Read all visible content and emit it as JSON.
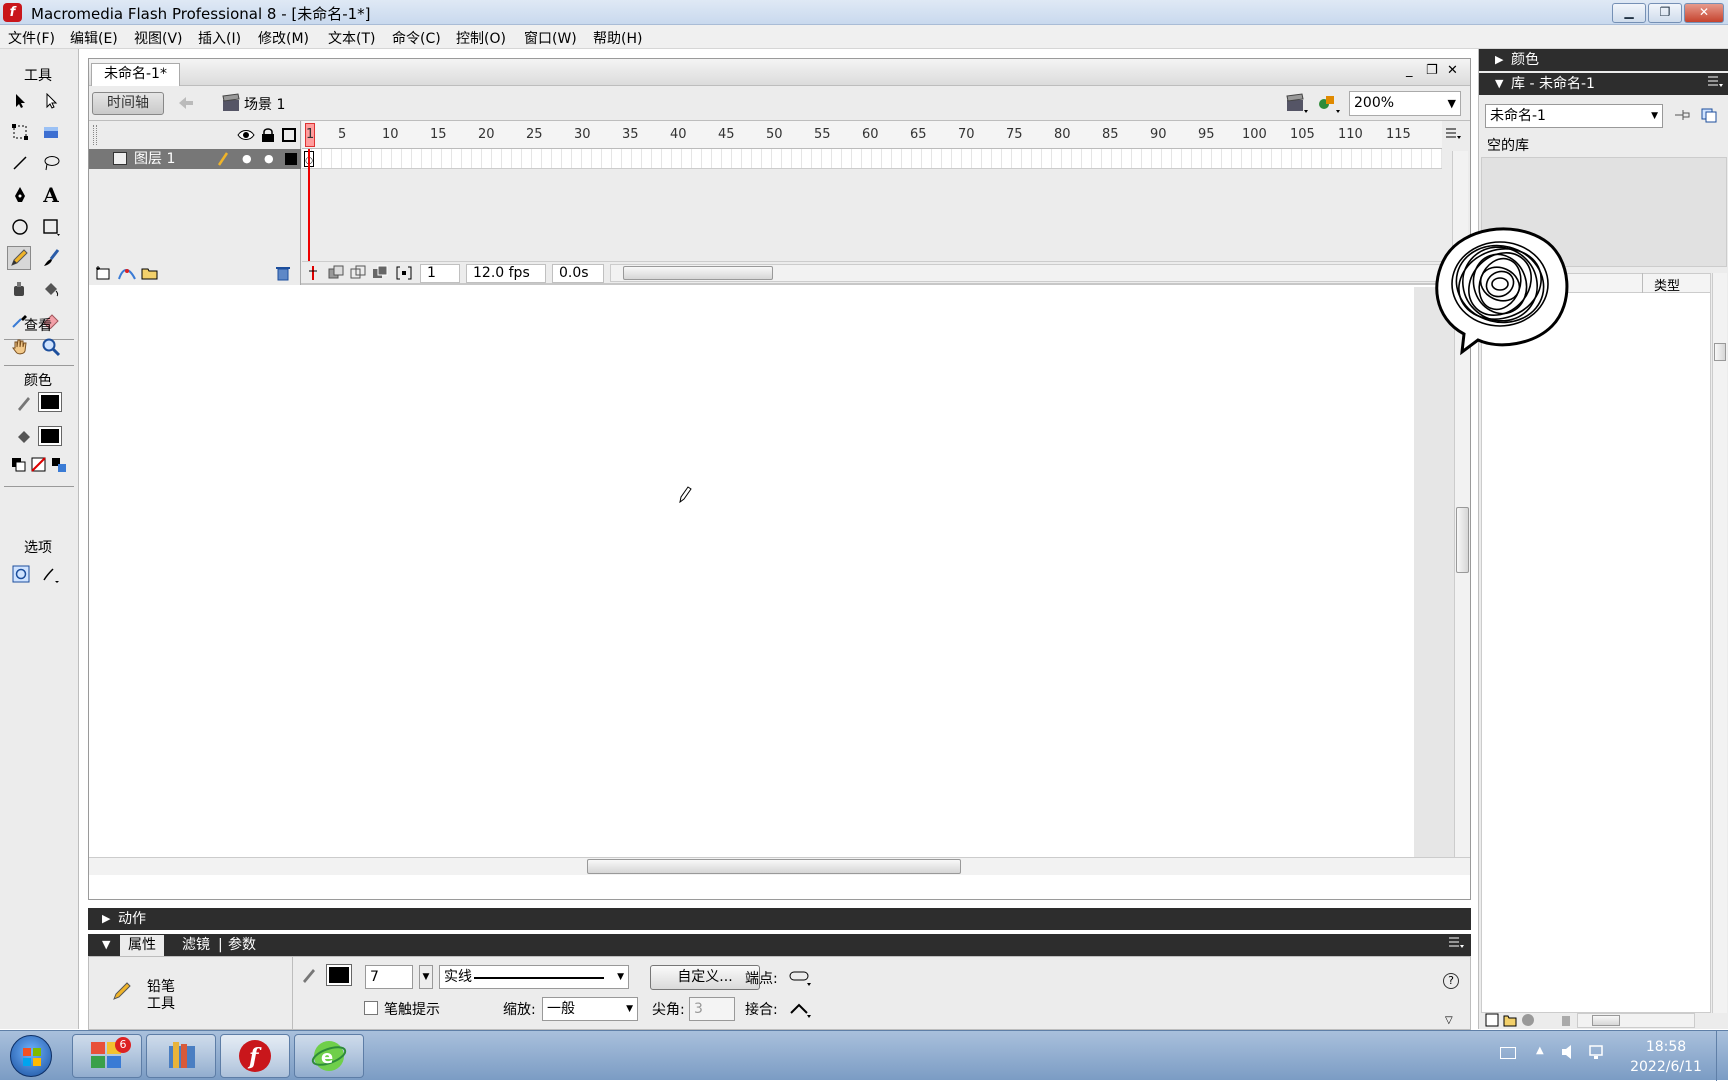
{
  "window": {
    "title": "Macromedia Flash Professional 8 - [未命名-1*]",
    "logo_glyph": "f"
  },
  "menu": [
    "文件(F)",
    "编辑(E)",
    "视图(V)",
    "插入(I)",
    "修改(M)",
    "文本(T)",
    "命令(C)",
    "控制(O)",
    "窗口(W)",
    "帮助(H)"
  ],
  "tools": {
    "heading": "工具",
    "view_heading": "查看",
    "colors_heading": "颜色",
    "options_heading": "选项",
    "active_tool": "pencil-tool"
  },
  "document": {
    "tab": "未命名-1*",
    "timeline_button": "时间轴",
    "scene": "场景 1",
    "zoom": "200%",
    "doc_controls": [
      "_",
      "❐",
      "✕"
    ]
  },
  "timeline": {
    "ruler": [
      "1",
      "5",
      "10",
      "15",
      "20",
      "25",
      "30",
      "35",
      "40",
      "45",
      "50",
      "55",
      "60",
      "65",
      "70",
      "75",
      "80",
      "85",
      "90",
      "95",
      "100",
      "105",
      "110",
      "115"
    ],
    "layer_name": "图层 1",
    "current_frame": "1",
    "fps": "12.0 fps",
    "time": "0.0s"
  },
  "panels": {
    "actions": "动作",
    "properties_tabs": [
      "属性",
      "滤镜",
      "参数"
    ]
  },
  "properties": {
    "tool_name_line1": "铅笔",
    "tool_name_line2": "工具",
    "stroke_height": "7",
    "stroke_style": "实线",
    "custom_button": "自定义...",
    "cap_label": "端点:",
    "stroke_hinting_label": "笔触提示",
    "scale_label": "缩放:",
    "scale_value": "一般",
    "miter_label": "尖角:",
    "miter_value": "3",
    "join_label": "接合:"
  },
  "right_panel": {
    "color_panel": "颜色",
    "library_panel": "库 - 未命名-1",
    "library_select": "未命名-1",
    "library_empty": "空的库",
    "type_column": "类型"
  },
  "taskbar": {
    "time": "18:58",
    "date": "2022/6/11",
    "badge": "6"
  },
  "colors": {
    "accent_red": "#c9161b",
    "panel_dark": "#2d2d2d",
    "layer_selected": "#777777"
  }
}
